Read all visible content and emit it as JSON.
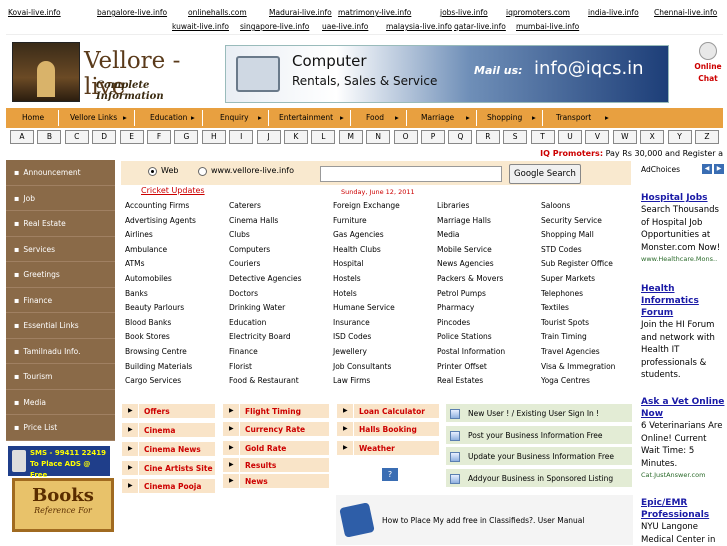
{
  "top_links": [
    "Kovai-live.info",
    "bangalore-live.info",
    "onlinehalls.com",
    "Madurai-live.info",
    "matrimony-live.info",
    "jobs-live.info",
    "iqpromoters.com",
    "india-live.info",
    "Chennai-live.info",
    "kuwait-live.info",
    "singapore-live.info",
    "uae-live.info",
    "malaysia-live.info",
    "qatar-live.info",
    "mumbai-live.info"
  ],
  "logo": {
    "title": "Vellore -live",
    "subtitle": "Complete Information"
  },
  "banner": {
    "line1": "Computer",
    "line2": "Rentals, Sales & Service",
    "mail_label": "Mail us:",
    "email": "info@iqcs.in"
  },
  "chat": {
    "line1": "Online",
    "line2": "Chat"
  },
  "nav": [
    "Home",
    "Vellore Links",
    "Education",
    "Enquiry",
    "Entertainment",
    "Food",
    "Marriage",
    "Shopping",
    "Transport"
  ],
  "alphabet": [
    "A",
    "B",
    "C",
    "D",
    "E",
    "F",
    "G",
    "H",
    "I",
    "J",
    "K",
    "L",
    "M",
    "N",
    "O",
    "P",
    "Q",
    "R",
    "S",
    "T",
    "U",
    "V",
    "W",
    "X",
    "Y",
    "Z"
  ],
  "promo": {
    "label": "IQ Promoters:",
    "text": "Pay Rs 30,000 and Register a"
  },
  "sidebar": [
    "Announcement",
    "Job",
    "Real Estate",
    "Services",
    "Greetings",
    "Finance",
    "Essential Links",
    "Tamilnadu Info.",
    "Tourism",
    "Media",
    "Price List"
  ],
  "sms_banner": {
    "line1": "SMS - 99411 22419",
    "line2": "To Place ADS @ Free"
  },
  "books_banner": {
    "title": "Books",
    "sub": "Reference For"
  },
  "search": {
    "option_web": "Web",
    "option_site": "www.vellore-live.info",
    "button": "Google Search",
    "query": ""
  },
  "cricket_link": "Cricket Updates",
  "date": "Sunday, June 12, 2011",
  "directory": [
    [
      "Accounting Firms",
      "Advertising Agents",
      "Airlines",
      "Ambulance",
      "ATMs",
      "Automobiles",
      "Banks",
      "Beauty Parlours",
      "Blood Banks",
      "Book Stores",
      "Browsing Centre",
      "Building Materials",
      "Cargo Services"
    ],
    [
      "Caterers",
      "Cinema Halls",
      "Clubs",
      "Computers",
      "Couriers",
      "Detective Agencies",
      "Doctors",
      "Drinking Water",
      "Education",
      "Electricity Board",
      "Finance",
      "Florist",
      "Food & Restaurant"
    ],
    [
      "Foreign Exchange",
      "Furniture",
      "Gas Agencies",
      "Health Clubs",
      "Hospital",
      "Hostels",
      "Hotels",
      "Humane Service",
      "Insurance",
      "ISD Codes",
      "Jewellery",
      "Job Consultants",
      "Law Firms"
    ],
    [
      "Libraries",
      "Marriage Halls",
      "Media",
      "Mobile Service",
      "News Agencies",
      "Packers & Movers",
      "Petrol Pumps",
      "Pharmacy",
      "Pincodes",
      "Police Stations",
      "Postal Information",
      "Printer Offset",
      "Real Estates"
    ],
    [
      "Saloons",
      "Security Service",
      "Shopping Mall",
      "STD Codes",
      "Sub Register Office",
      "Super Markets",
      "Telephones",
      "Textiles",
      "Tourist Spots",
      "Train Timing",
      "Travel Agencies",
      "Visa & Immegration",
      "Yoga Centres"
    ]
  ],
  "quick_links": {
    "col1": [
      "Offers",
      "Cinema",
      "Cinema News",
      "Cine Artists Site",
      "Cinema Pooja"
    ],
    "col2": [
      "Flight Timing",
      "Currency Rate",
      "Gold Rate",
      "Results",
      "News"
    ],
    "col3": [
      "Loan Calculator",
      "Halls Booking",
      "Weather"
    ],
    "help": "?"
  },
  "services": [
    "New User ! / Existing User Sign In !",
    "Post your Business Information Free",
    "Update your Business Information Free",
    "Addyour Business in Sponsored Listing"
  ],
  "classified": "How to Place My add free in Classifieds?. User Manual",
  "ads": {
    "choices": "AdChoices",
    "items": [
      {
        "title": "Hospital Jobs",
        "desc": "Search Thousands of Hospital Job Opportunities at Monster.com Now!",
        "url": "www.Healthcare.Mons.."
      },
      {
        "title": "Health Informatics Forum",
        "desc": "Join the HI Forum and network with Health IT professionals & students.",
        "url": ""
      },
      {
        "title": "Ask a Vet Online Now",
        "desc": "6 Veterinarians Are Online! Current Wait Time: 5 Minutes.",
        "url": "Cat.JustAnswer.com"
      },
      {
        "title": "Epic/EMR Professionals",
        "desc": "NYU Langone Medical Center in",
        "url": ""
      }
    ]
  }
}
